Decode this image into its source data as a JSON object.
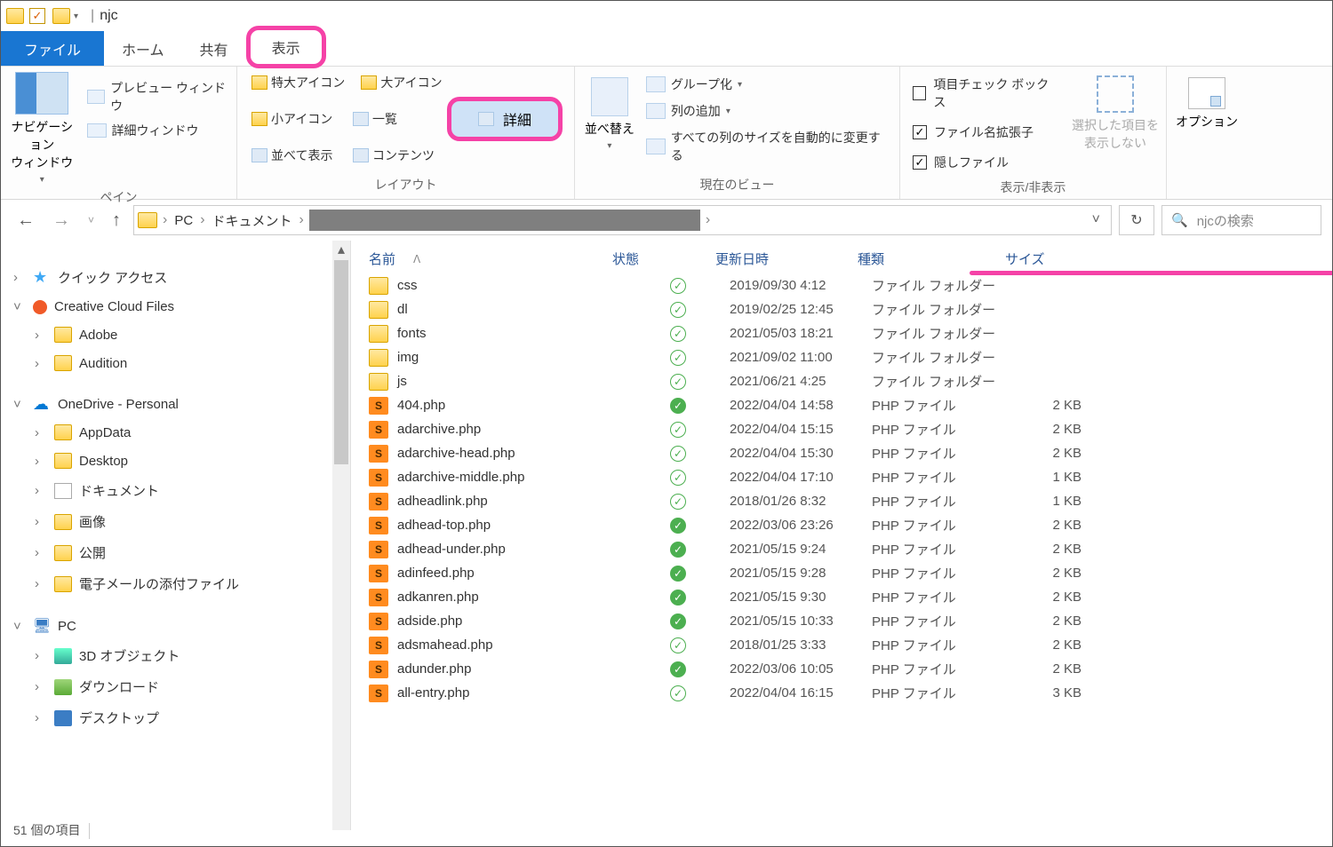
{
  "title": "njc",
  "tabs": {
    "file": "ファイル",
    "home": "ホーム",
    "share": "共有",
    "view": "表示"
  },
  "ribbon": {
    "pane": {
      "nav": "ナビゲーション\nウィンドウ",
      "preview": "プレビュー ウィンドウ",
      "detail": "詳細ウィンドウ",
      "label": "ペイン"
    },
    "layout": {
      "xl": "特大アイコン",
      "l": "大アイコン",
      "s": "小アイコン",
      "list": "一覧",
      "tile": "並べて表示",
      "content": "コンテンツ",
      "details": "詳細",
      "label": "レイアウト"
    },
    "view": {
      "sort": "並べ替え",
      "group": "グループ化",
      "addcol": "列の追加",
      "autosize": "すべての列のサイズを自動的に変更する",
      "label": "現在のビュー"
    },
    "show": {
      "checkbox": "項目チェック ボックス",
      "ext": "ファイル名拡張子",
      "hidden": "隠しファイル",
      "selected": "選択した項目を\n表示しない",
      "label": "表示/非表示"
    },
    "options": "オプション"
  },
  "address": {
    "pc": "PC",
    "docs": "ドキュメント"
  },
  "search": {
    "placeholder": "njcの検索"
  },
  "tree": [
    {
      "d": 0,
      "exp": ">",
      "ico": "star",
      "label": "クイック アクセス"
    },
    {
      "d": 0,
      "exp": "v",
      "ico": "cc",
      "label": "Creative Cloud Files"
    },
    {
      "d": 1,
      "exp": ">",
      "ico": "folder",
      "label": "Adobe"
    },
    {
      "d": 1,
      "exp": ">",
      "ico": "folder",
      "label": "Audition"
    },
    {
      "d": 0,
      "exp": "v",
      "ico": "cloud",
      "label": "OneDrive - Personal"
    },
    {
      "d": 1,
      "exp": ">",
      "ico": "folder",
      "label": "AppData"
    },
    {
      "d": 1,
      "exp": ">",
      "ico": "folder",
      "label": "Desktop"
    },
    {
      "d": 1,
      "exp": ">",
      "ico": "doc",
      "label": "ドキュメント"
    },
    {
      "d": 1,
      "exp": ">",
      "ico": "folder",
      "label": "画像"
    },
    {
      "d": 1,
      "exp": ">",
      "ico": "folder",
      "label": "公開"
    },
    {
      "d": 1,
      "exp": ">",
      "ico": "folder",
      "label": "電子メールの添付ファイル"
    },
    {
      "d": 0,
      "exp": "v",
      "ico": "pc",
      "label": "PC"
    },
    {
      "d": 1,
      "exp": ">",
      "ico": "obj",
      "label": "3D オブジェクト"
    },
    {
      "d": 1,
      "exp": ">",
      "ico": "dl",
      "label": "ダウンロード"
    },
    {
      "d": 1,
      "exp": ">",
      "ico": "mon",
      "label": "デスクトップ"
    }
  ],
  "columns": {
    "name": "名前",
    "state": "状態",
    "date": "更新日時",
    "type": "種類",
    "size": "サイズ"
  },
  "files": [
    {
      "ico": "folder",
      "name": "css",
      "state": "outline",
      "date": "2019/09/30 4:12",
      "type": "ファイル フォルダー",
      "size": ""
    },
    {
      "ico": "folder",
      "name": "dl",
      "state": "outline",
      "date": "2019/02/25 12:45",
      "type": "ファイル フォルダー",
      "size": ""
    },
    {
      "ico": "folder",
      "name": "fonts",
      "state": "outline",
      "date": "2021/05/03 18:21",
      "type": "ファイル フォルダー",
      "size": ""
    },
    {
      "ico": "folder",
      "name": "img",
      "state": "outline",
      "date": "2021/09/02 11:00",
      "type": "ファイル フォルダー",
      "size": ""
    },
    {
      "ico": "folder",
      "name": "js",
      "state": "outline",
      "date": "2021/06/21 4:25",
      "type": "ファイル フォルダー",
      "size": ""
    },
    {
      "ico": "php",
      "name": "404.php",
      "state": "solid",
      "date": "2022/04/04 14:58",
      "type": "PHP ファイル",
      "size": "2 KB"
    },
    {
      "ico": "php",
      "name": "adarchive.php",
      "state": "outline",
      "date": "2022/04/04 15:15",
      "type": "PHP ファイル",
      "size": "2 KB"
    },
    {
      "ico": "php",
      "name": "adarchive-head.php",
      "state": "outline",
      "date": "2022/04/04 15:30",
      "type": "PHP ファイル",
      "size": "2 KB"
    },
    {
      "ico": "php",
      "name": "adarchive-middle.php",
      "state": "outline",
      "date": "2022/04/04 17:10",
      "type": "PHP ファイル",
      "size": "1 KB"
    },
    {
      "ico": "php",
      "name": "adheadlink.php",
      "state": "outline",
      "date": "2018/01/26 8:32",
      "type": "PHP ファイル",
      "size": "1 KB"
    },
    {
      "ico": "php",
      "name": "adhead-top.php",
      "state": "solid",
      "date": "2022/03/06 23:26",
      "type": "PHP ファイル",
      "size": "2 KB"
    },
    {
      "ico": "php",
      "name": "adhead-under.php",
      "state": "solid",
      "date": "2021/05/15 9:24",
      "type": "PHP ファイル",
      "size": "2 KB"
    },
    {
      "ico": "php",
      "name": "adinfeed.php",
      "state": "solid",
      "date": "2021/05/15 9:28",
      "type": "PHP ファイル",
      "size": "2 KB"
    },
    {
      "ico": "php",
      "name": "adkanren.php",
      "state": "solid",
      "date": "2021/05/15 9:30",
      "type": "PHP ファイル",
      "size": "2 KB"
    },
    {
      "ico": "php",
      "name": "adside.php",
      "state": "solid",
      "date": "2021/05/15 10:33",
      "type": "PHP ファイル",
      "size": "2 KB"
    },
    {
      "ico": "php",
      "name": "adsmahead.php",
      "state": "outline",
      "date": "2018/01/25 3:33",
      "type": "PHP ファイル",
      "size": "2 KB"
    },
    {
      "ico": "php",
      "name": "adunder.php",
      "state": "solid",
      "date": "2022/03/06 10:05",
      "type": "PHP ファイル",
      "size": "2 KB"
    },
    {
      "ico": "php",
      "name": "all-entry.php",
      "state": "outline",
      "date": "2022/04/04 16:15",
      "type": "PHP ファイル",
      "size": "3 KB"
    }
  ],
  "status": "51 個の項目"
}
